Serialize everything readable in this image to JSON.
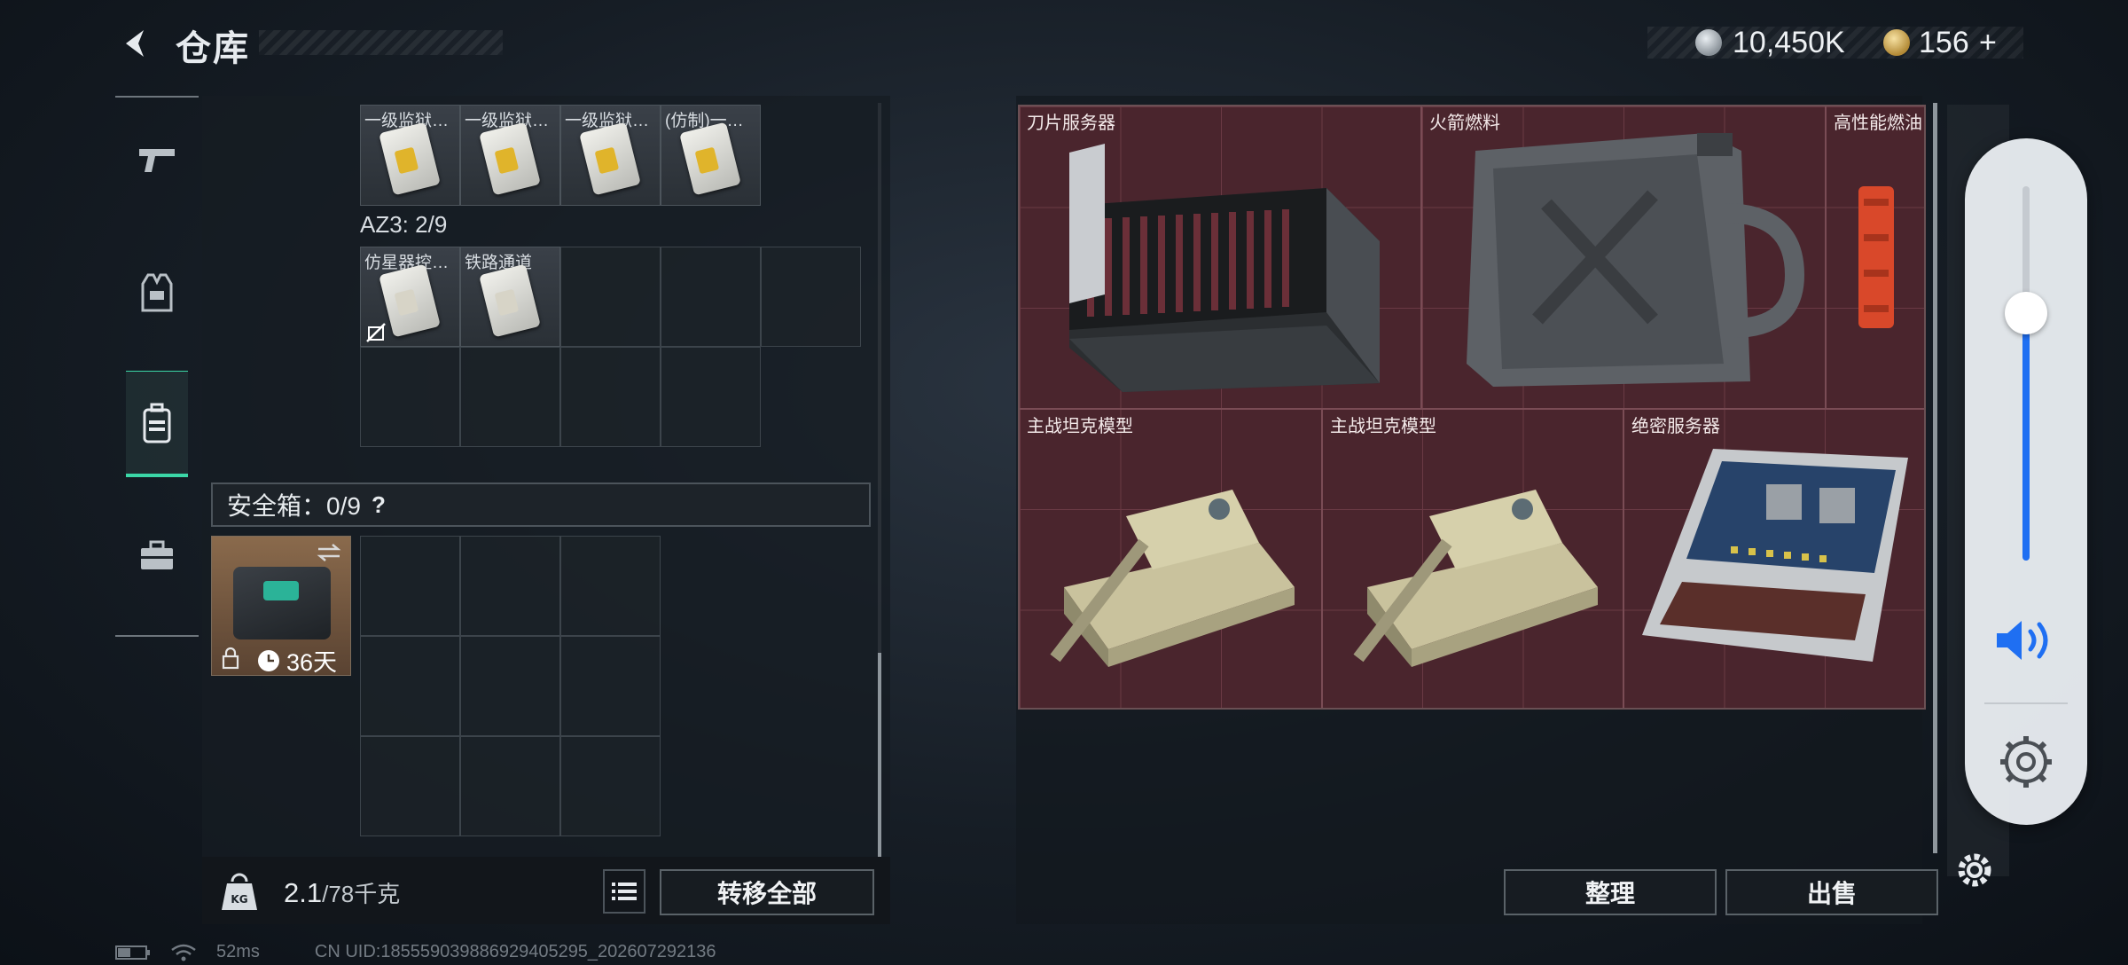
{
  "header": {
    "title": "仓库",
    "currency_primary": "10,450K",
    "currency_secondary": "156",
    "currency_add": "+"
  },
  "nav": {
    "items": [
      {
        "name": "weapons",
        "icon": "pistol-icon"
      },
      {
        "name": "equipment",
        "icon": "vest-icon"
      },
      {
        "name": "backpack",
        "icon": "backpack-icon",
        "active": true
      },
      {
        "name": "toolbox",
        "icon": "toolbox-icon"
      }
    ]
  },
  "inventory": {
    "top_row_items": [
      "一级监狱…",
      "一级监狱…",
      "一级监狱…",
      "(仿制)一…"
    ],
    "az3_label": "AZ3: 2/9",
    "az3_items": [
      "仿星器控…",
      "铁路通道"
    ],
    "safe_box_label": "安全箱：0/9",
    "safe_box_help": "?",
    "safe_box_timer": "36天",
    "weight_current": "2.1",
    "weight_max": "/78千克",
    "transfer_all": "转移全部"
  },
  "loot": {
    "items": [
      {
        "label": "刀片服务器"
      },
      {
        "label": "火箭燃料"
      },
      {
        "label": "高性能燃油"
      },
      {
        "label": "主战坦克模型"
      },
      {
        "label": "主战坦克模型"
      },
      {
        "label": "绝密服务器"
      }
    ],
    "sort_button": "整理",
    "sell_button": "出售"
  },
  "status": {
    "ping": "52ms",
    "uid": "CN UID:185559039886929405295_202607292136"
  },
  "colors": {
    "accent_green": "#3bd7a7",
    "loot_bg": "#4a252d",
    "volume_blue": "#1f6ff2"
  },
  "volume_level": 0.66
}
